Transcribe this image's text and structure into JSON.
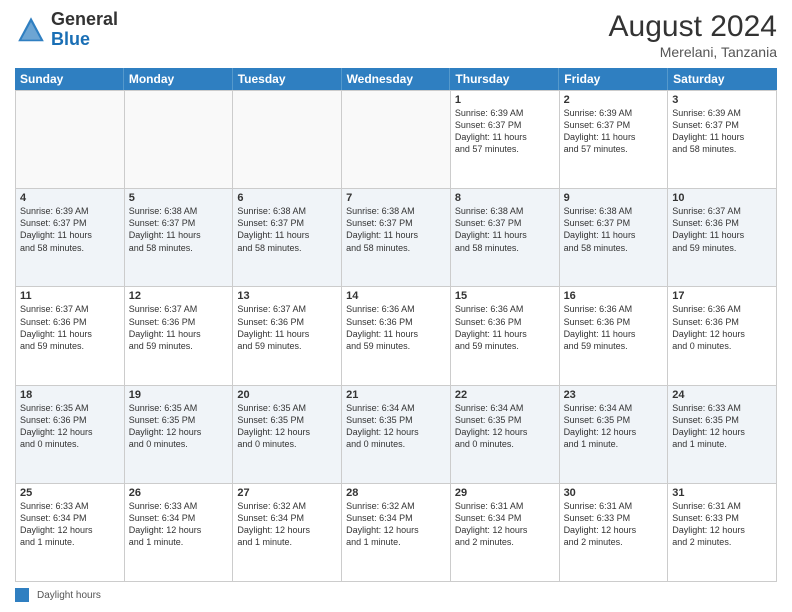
{
  "header": {
    "logo_line1": "General",
    "logo_line2": "Blue",
    "month_year": "August 2024",
    "location": "Merelani, Tanzania"
  },
  "days_of_week": [
    "Sunday",
    "Monday",
    "Tuesday",
    "Wednesday",
    "Thursday",
    "Friday",
    "Saturday"
  ],
  "weeks": [
    [
      {
        "day": "",
        "info": ""
      },
      {
        "day": "",
        "info": ""
      },
      {
        "day": "",
        "info": ""
      },
      {
        "day": "",
        "info": ""
      },
      {
        "day": "1",
        "info": "Sunrise: 6:39 AM\nSunset: 6:37 PM\nDaylight: 11 hours\nand 57 minutes."
      },
      {
        "day": "2",
        "info": "Sunrise: 6:39 AM\nSunset: 6:37 PM\nDaylight: 11 hours\nand 57 minutes."
      },
      {
        "day": "3",
        "info": "Sunrise: 6:39 AM\nSunset: 6:37 PM\nDaylight: 11 hours\nand 58 minutes."
      }
    ],
    [
      {
        "day": "4",
        "info": "Sunrise: 6:39 AM\nSunset: 6:37 PM\nDaylight: 11 hours\nand 58 minutes."
      },
      {
        "day": "5",
        "info": "Sunrise: 6:38 AM\nSunset: 6:37 PM\nDaylight: 11 hours\nand 58 minutes."
      },
      {
        "day": "6",
        "info": "Sunrise: 6:38 AM\nSunset: 6:37 PM\nDaylight: 11 hours\nand 58 minutes."
      },
      {
        "day": "7",
        "info": "Sunrise: 6:38 AM\nSunset: 6:37 PM\nDaylight: 11 hours\nand 58 minutes."
      },
      {
        "day": "8",
        "info": "Sunrise: 6:38 AM\nSunset: 6:37 PM\nDaylight: 11 hours\nand 58 minutes."
      },
      {
        "day": "9",
        "info": "Sunrise: 6:38 AM\nSunset: 6:37 PM\nDaylight: 11 hours\nand 58 minutes."
      },
      {
        "day": "10",
        "info": "Sunrise: 6:37 AM\nSunset: 6:36 PM\nDaylight: 11 hours\nand 59 minutes."
      }
    ],
    [
      {
        "day": "11",
        "info": "Sunrise: 6:37 AM\nSunset: 6:36 PM\nDaylight: 11 hours\nand 59 minutes."
      },
      {
        "day": "12",
        "info": "Sunrise: 6:37 AM\nSunset: 6:36 PM\nDaylight: 11 hours\nand 59 minutes."
      },
      {
        "day": "13",
        "info": "Sunrise: 6:37 AM\nSunset: 6:36 PM\nDaylight: 11 hours\nand 59 minutes."
      },
      {
        "day": "14",
        "info": "Sunrise: 6:36 AM\nSunset: 6:36 PM\nDaylight: 11 hours\nand 59 minutes."
      },
      {
        "day": "15",
        "info": "Sunrise: 6:36 AM\nSunset: 6:36 PM\nDaylight: 11 hours\nand 59 minutes."
      },
      {
        "day": "16",
        "info": "Sunrise: 6:36 AM\nSunset: 6:36 PM\nDaylight: 11 hours\nand 59 minutes."
      },
      {
        "day": "17",
        "info": "Sunrise: 6:36 AM\nSunset: 6:36 PM\nDaylight: 12 hours\nand 0 minutes."
      }
    ],
    [
      {
        "day": "18",
        "info": "Sunrise: 6:35 AM\nSunset: 6:36 PM\nDaylight: 12 hours\nand 0 minutes."
      },
      {
        "day": "19",
        "info": "Sunrise: 6:35 AM\nSunset: 6:35 PM\nDaylight: 12 hours\nand 0 minutes."
      },
      {
        "day": "20",
        "info": "Sunrise: 6:35 AM\nSunset: 6:35 PM\nDaylight: 12 hours\nand 0 minutes."
      },
      {
        "day": "21",
        "info": "Sunrise: 6:34 AM\nSunset: 6:35 PM\nDaylight: 12 hours\nand 0 minutes."
      },
      {
        "day": "22",
        "info": "Sunrise: 6:34 AM\nSunset: 6:35 PM\nDaylight: 12 hours\nand 0 minutes."
      },
      {
        "day": "23",
        "info": "Sunrise: 6:34 AM\nSunset: 6:35 PM\nDaylight: 12 hours\nand 1 minute."
      },
      {
        "day": "24",
        "info": "Sunrise: 6:33 AM\nSunset: 6:35 PM\nDaylight: 12 hours\nand 1 minute."
      }
    ],
    [
      {
        "day": "25",
        "info": "Sunrise: 6:33 AM\nSunset: 6:34 PM\nDaylight: 12 hours\nand 1 minute."
      },
      {
        "day": "26",
        "info": "Sunrise: 6:33 AM\nSunset: 6:34 PM\nDaylight: 12 hours\nand 1 minute."
      },
      {
        "day": "27",
        "info": "Sunrise: 6:32 AM\nSunset: 6:34 PM\nDaylight: 12 hours\nand 1 minute."
      },
      {
        "day": "28",
        "info": "Sunrise: 6:32 AM\nSunset: 6:34 PM\nDaylight: 12 hours\nand 1 minute."
      },
      {
        "day": "29",
        "info": "Sunrise: 6:31 AM\nSunset: 6:34 PM\nDaylight: 12 hours\nand 2 minutes."
      },
      {
        "day": "30",
        "info": "Sunrise: 6:31 AM\nSunset: 6:33 PM\nDaylight: 12 hours\nand 2 minutes."
      },
      {
        "day": "31",
        "info": "Sunrise: 6:31 AM\nSunset: 6:33 PM\nDaylight: 12 hours\nand 2 minutes."
      }
    ]
  ],
  "footer": {
    "legend_label": "Daylight hours"
  }
}
